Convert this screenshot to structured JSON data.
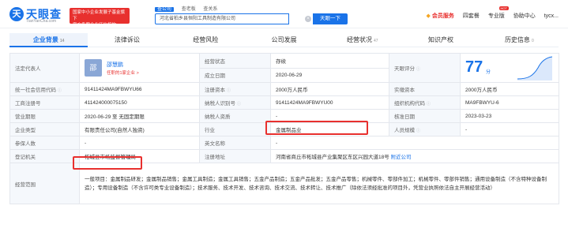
{
  "header": {
    "logo_mark": "天",
    "logo_name": "天眼查",
    "logo_url": "TianYanCha.com",
    "banner_line1": "国家中小企业发展子基金旗下",
    "banner_line2": "官方备案企业征信机构",
    "search_tabs": [
      "查公司",
      "查老板",
      "查关系"
    ],
    "search_value": "河北省柏乡县恒阳工具制造有限公司",
    "search_button": "天眼一下",
    "hot_badge": "HOT",
    "nav": [
      "会员服务",
      "四套餐",
      "专业版",
      "协助中心",
      "tycx..."
    ]
  },
  "tabs": [
    {
      "label": "企业背景",
      "count": "14",
      "active": true
    },
    {
      "label": "法律诉讼",
      "count": "",
      "active": false
    },
    {
      "label": "经营风险",
      "count": "",
      "active": false
    },
    {
      "label": "公司发展",
      "count": "",
      "active": false
    },
    {
      "label": "经营状况",
      "count": "47",
      "active": false
    },
    {
      "label": "知识产权",
      "count": "",
      "active": false
    },
    {
      "label": "历史信息",
      "count": "0",
      "active": false
    }
  ],
  "info": {
    "legal_rep_label": "法定代表人",
    "legal_rep_avatar": "邵",
    "legal_rep_name": "邵慧鹏",
    "legal_rep_sub": "任职的1家企业 >",
    "status_label": "经营状态",
    "status_value": "存续",
    "founded_label": "成立日期",
    "founded_value": "2020-06-29",
    "score_label": "天眼评分",
    "score_value": "77",
    "score_unit": "分",
    "credit_code_label": "统一社会信用代码",
    "credit_code_value": "91411424MA9FBWYU66",
    "reg_capital_label": "注册资本",
    "reg_capital_value": "2000万人民币",
    "paid_capital_label": "实缴资本",
    "paid_capital_value": "2000万人民币",
    "biz_reg_label": "工商注册号",
    "biz_reg_value": "411424000075150",
    "taxpayer_id_label": "纳税人识别号",
    "taxpayer_id_value": "91411424MA9FBWYU00",
    "org_code_label": "组织机构代码",
    "org_code_value": "MA9FBWYU-6",
    "term_label": "营业期限",
    "term_value": "2020-06-29 至 无固定期限",
    "taxpayer_qual_label": "纳税人资质",
    "taxpayer_qual_value": "-",
    "approval_label": "核准日期",
    "approval_value": "2023-03-23",
    "type_label": "企业类型",
    "type_value": "有限责任公司(自然人独资)",
    "industry_label": "行业",
    "industry_value": "金属制品业",
    "staff_label": "人员规模",
    "staff_value": "-",
    "insured_label": "参保人数",
    "insured_value": "-",
    "en_name_label": "英文名称",
    "en_name_value": "-",
    "authority_label": "登记机关",
    "authority_value": "柘城县市场监督管理局",
    "address_label": "注册地址",
    "address_value": "河南省商丘市柘城县产业集聚区东区兴园大道18号",
    "address_link": "附近公司",
    "scope_label": "经营范围",
    "scope_value": "一般项目：金属制品研发；金属制品销售；金属工具制造；金属工具销售；五金产品制造；五金产品批发；五金产品零售；机械零件、零部件加工；机械零件、零部件销售；通用设备制造（不含特种设备制造）；专用设备制造（不含许可类专业设备制造）；技术服务、技术开发、技术咨询、技术交流、技术转让、技术推广（除依法须经批准的项目外，凭营业执照依法自主开展经营活动）"
  },
  "colors": {
    "accent": "#1a73e8",
    "highlight": "#e8302e",
    "status": "#20a56b"
  }
}
